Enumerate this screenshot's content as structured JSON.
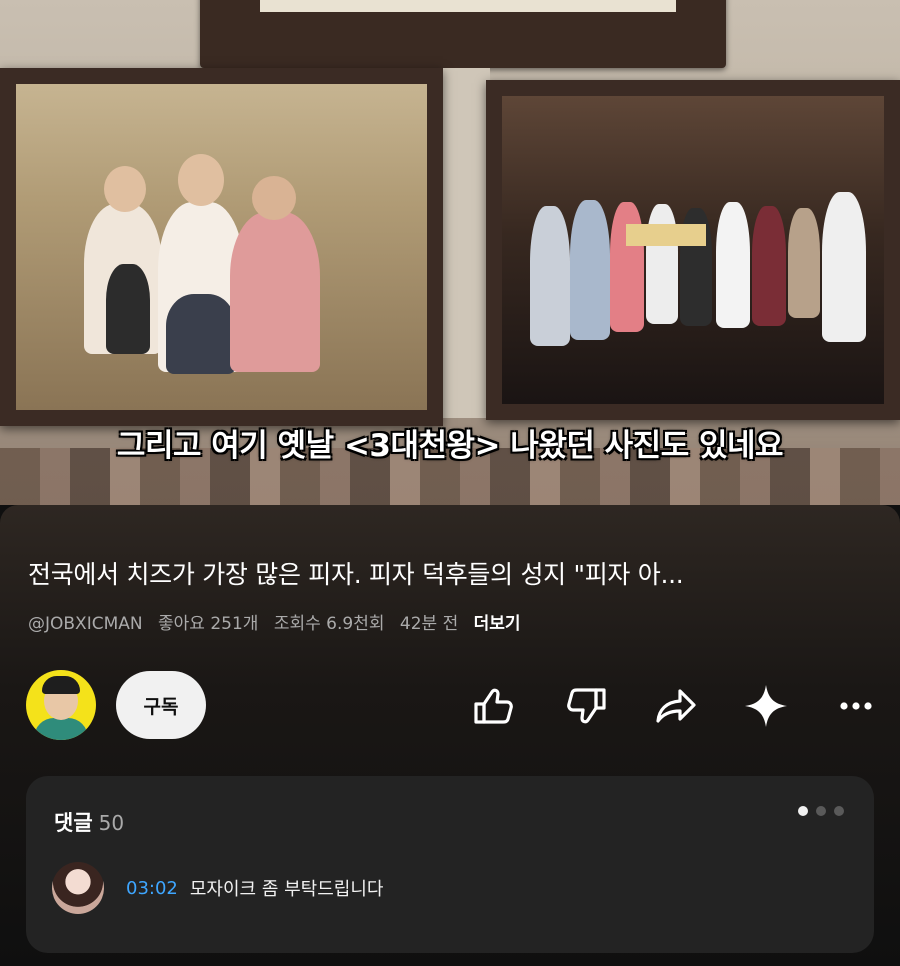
{
  "video": {
    "caption": "그리고 여기 옛날 <3대천왕> 나왔던 사진도 있네요",
    "title": "전국에서 치즈가 가장 많은 피자. 피자 덕후들의 성지 \"피자 아...",
    "meta": {
      "channel": "@JOBXICMAN",
      "likes": "좋아요 251개",
      "views": "조회수 6.9천회",
      "time": "42분 전",
      "more": "더보기"
    }
  },
  "actions": {
    "subscribe_label": "구독",
    "icons": [
      "thumbs-up-icon",
      "thumbs-down-icon",
      "share-icon",
      "sparkle-icon",
      "more-icon"
    ]
  },
  "comments": {
    "header": "댓글",
    "count": "50",
    "pager_dots": 3,
    "first": {
      "timestamp": "03:02",
      "text": "모자이크 좀 부탁드립니다"
    }
  }
}
